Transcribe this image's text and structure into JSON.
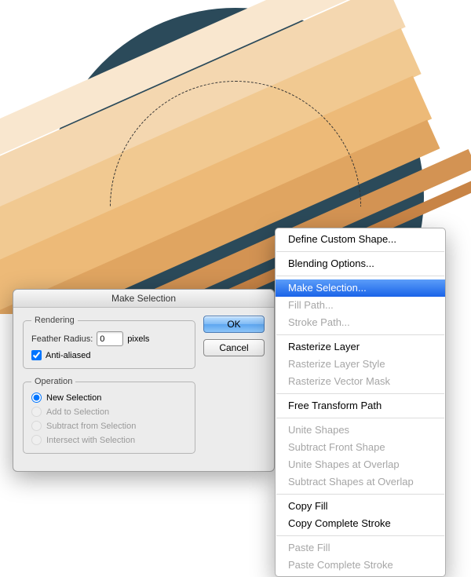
{
  "dialog": {
    "title": "Make Selection",
    "rendering_legend": "Rendering",
    "feather_label": "Feather Radius:",
    "feather_value": "0",
    "feather_unit": "pixels",
    "antialiased_label": "Anti-aliased",
    "operation_legend": "Operation",
    "op_new": "New Selection",
    "op_add": "Add to Selection",
    "op_sub": "Subtract from Selection",
    "op_int": "Intersect with Selection",
    "ok": "OK",
    "cancel": "Cancel"
  },
  "menu": {
    "items": [
      {
        "label": "Define Custom Shape...",
        "enabled": true
      },
      {
        "sep": true
      },
      {
        "label": "Blending Options...",
        "enabled": true
      },
      {
        "sep": true
      },
      {
        "label": "Make Selection...",
        "enabled": true,
        "selected": true
      },
      {
        "label": "Fill Path...",
        "enabled": false
      },
      {
        "label": "Stroke Path...",
        "enabled": false
      },
      {
        "sep": true
      },
      {
        "label": "Rasterize Layer",
        "enabled": true
      },
      {
        "label": "Rasterize Layer Style",
        "enabled": false
      },
      {
        "label": "Rasterize Vector Mask",
        "enabled": false
      },
      {
        "sep": true
      },
      {
        "label": "Free Transform Path",
        "enabled": true
      },
      {
        "sep": true
      },
      {
        "label": "Unite Shapes",
        "enabled": false
      },
      {
        "label": "Subtract Front Shape",
        "enabled": false
      },
      {
        "label": "Unite Shapes at Overlap",
        "enabled": false
      },
      {
        "label": "Subtract Shapes at Overlap",
        "enabled": false
      },
      {
        "sep": true
      },
      {
        "label": "Copy Fill",
        "enabled": true
      },
      {
        "label": "Copy Complete Stroke",
        "enabled": true
      },
      {
        "sep": true
      },
      {
        "label": "Paste Fill",
        "enabled": false
      },
      {
        "label": "Paste Complete Stroke",
        "enabled": false
      }
    ]
  }
}
